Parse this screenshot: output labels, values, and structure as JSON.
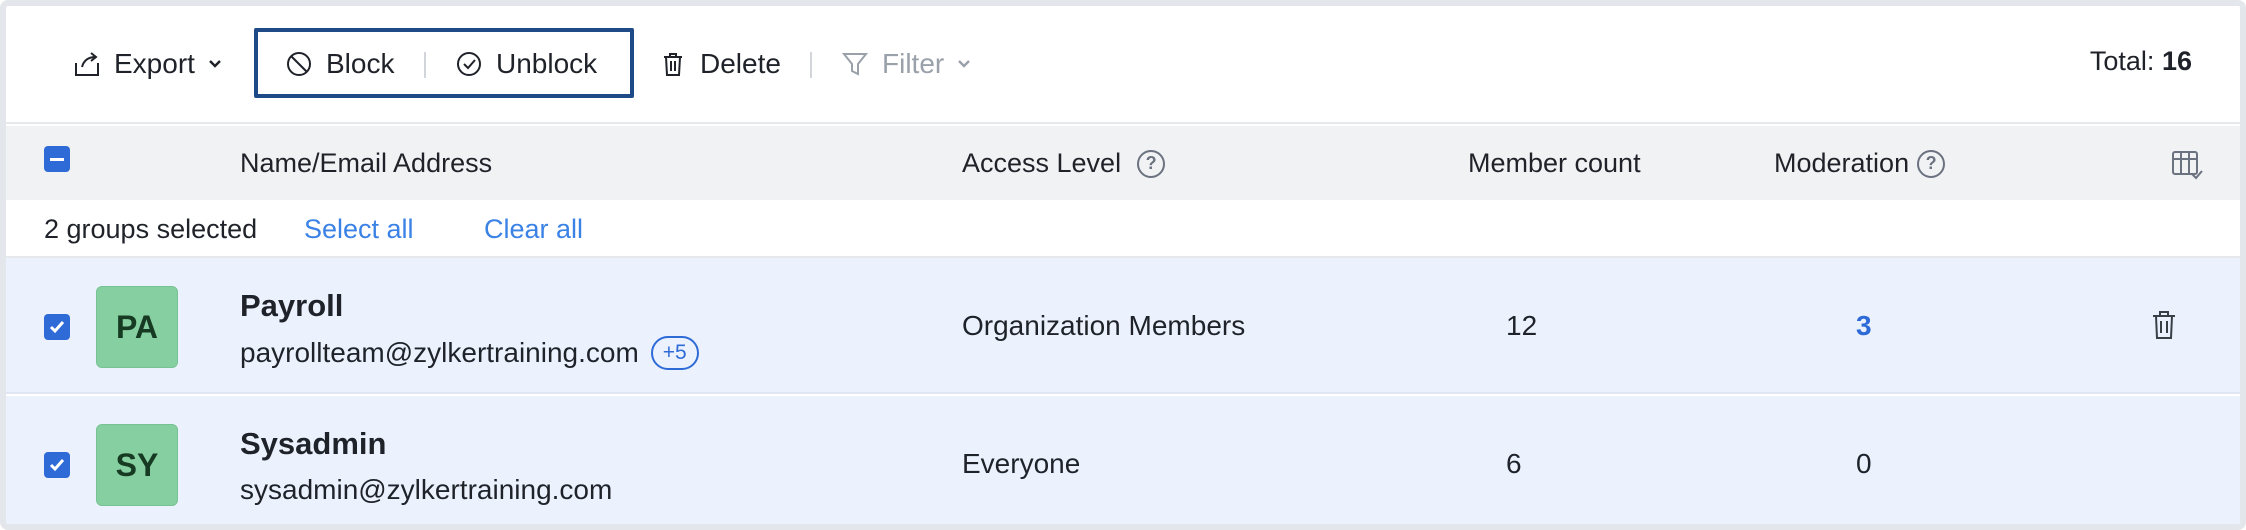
{
  "toolbar": {
    "export_label": "Export",
    "block_label": "Block",
    "unblock_label": "Unblock",
    "delete_label": "Delete",
    "filter_label": "Filter",
    "total_label": "Total:",
    "total_value": "16"
  },
  "table": {
    "headers": {
      "name": "Name/Email Address",
      "access": "Access Level",
      "members": "Member count",
      "moderation": "Moderation"
    },
    "help_glyph": "?"
  },
  "selection": {
    "text": "2 groups selected",
    "select_all": "Select all",
    "clear_all": "Clear all"
  },
  "rows": [
    {
      "initials": "PA",
      "name": "Payroll",
      "email": "payrollteam@zylkertraining.com",
      "alias_badge": "+5",
      "access": "Organization Members",
      "members": "12",
      "moderation": "3"
    },
    {
      "initials": "SY",
      "name": "Sysadmin",
      "email": "sysadmin@zylkertraining.com",
      "access": "Everyone",
      "members": "6",
      "moderation": "0"
    }
  ],
  "colors": {
    "accent": "#2f6bd7",
    "link": "#3b82e6",
    "row_selected": "#ebf2fe",
    "avatar": "#86cfa1",
    "highlight_box": "#1e4a87"
  },
  "icons": [
    "export-icon",
    "block-icon",
    "unblock-icon",
    "trash-icon",
    "filter-icon",
    "chevron-down-icon",
    "help-icon",
    "column-settings-icon",
    "checkmark-icon"
  ]
}
